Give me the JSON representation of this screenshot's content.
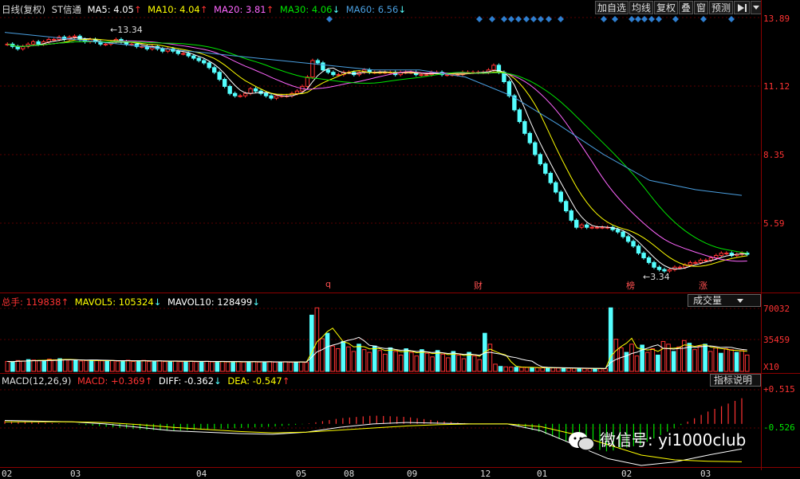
{
  "header": {
    "title": "日线(复权)",
    "stock": "ST信通",
    "ma5": "MA5: 4.05",
    "ma10": "MA10: 4.04",
    "ma20": "MA20: 3.81",
    "ma30": "MA30: 4.06",
    "ma60": "MA60: 6.56",
    "ma5_arrow": "↑",
    "ma10_arrow": "↑",
    "ma20_arrow": "↑",
    "ma30_arrow": "↓",
    "ma60_arrow": "↓",
    "buttons": [
      "加自选",
      "均线",
      "复权",
      "叠",
      "窗",
      "预测"
    ],
    "nav_icon": "play-icon",
    "dropdown_icon": "chevron-down-icon"
  },
  "colors": {
    "up": "#ff3232",
    "down": "#54ffff",
    "ma5": "#ffffff",
    "ma10": "#ffff00",
    "ma20": "#ff66ff",
    "ma30": "#00e600",
    "ma60": "#4a9fe0",
    "grid": "#8b0000"
  },
  "price_axis": [
    "13.89",
    "11.12",
    "8.35",
    "5.59"
  ],
  "annotations": {
    "high": "13.34",
    "low": "3.34"
  },
  "event_markers": [
    "q",
    "财",
    "榜",
    "涨"
  ],
  "volume_panel": {
    "total": "总手: 119838",
    "mavol5": "MAVOL5: 105324",
    "mavol10": "MAVOL10: 128499",
    "total_arrow": "↑",
    "mavol5_arrow": "↓",
    "mavol10_arrow": "↓",
    "selector": "成交量",
    "axis": [
      "70032",
      "35459",
      "X10"
    ]
  },
  "macd_panel": {
    "name": "MACD(12,26,9)",
    "macd": "MACD: +0.369",
    "diff": "DIFF: -0.362",
    "dea": "DEA: -0.547",
    "macd_arrow": "↑",
    "diff_arrow": "↓",
    "dea_arrow": "↑",
    "help": "指标说明",
    "axis": [
      "+0.515",
      "-0.526"
    ]
  },
  "x_dates": [
    "02",
    "03",
    "04",
    "05",
    "08",
    "09",
    "12",
    "01",
    "02",
    "03"
  ],
  "watermark": "微信号: yi1000club",
  "chart_data": {
    "type": "candlestick",
    "ylim": [
      3.0,
      14.2
    ],
    "close": [
      13.0,
      12.9,
      12.8,
      12.9,
      13.0,
      13.1,
      13.0,
      13.1,
      13.2,
      13.2,
      13.3,
      13.2,
      13.3,
      13.34,
      13.2,
      13.1,
      13.2,
      13.1,
      13.0,
      13.0,
      13.1,
      13.2,
      13.1,
      13.0,
      13.0,
      12.9,
      12.9,
      12.8,
      12.9,
      12.8,
      12.7,
      12.8,
      12.7,
      12.6,
      12.6,
      12.5,
      12.4,
      12.3,
      12.2,
      12.0,
      11.8,
      11.5,
      11.2,
      10.9,
      10.8,
      10.8,
      10.9,
      11.1,
      11.0,
      10.9,
      10.8,
      10.7,
      10.8,
      10.8,
      10.8,
      10.9,
      11.0,
      11.2,
      11.6,
      12.3,
      12.2,
      11.9,
      11.8,
      11.7,
      11.7,
      11.8,
      11.8,
      11.7,
      11.8,
      11.9,
      11.8,
      11.8,
      11.8,
      11.8,
      11.8,
      11.7,
      11.8,
      11.8,
      11.8,
      11.7,
      11.7,
      11.7,
      11.8,
      11.8,
      11.7,
      11.7,
      11.7,
      11.7,
      11.8,
      11.8,
      11.8,
      11.8,
      11.8,
      11.9,
      12.1,
      11.8,
      11.4,
      10.8,
      10.2,
      9.7,
      9.2,
      8.8,
      8.3,
      7.9,
      7.5,
      7.1,
      6.7,
      6.3,
      5.9,
      5.5,
      5.2,
      5.3,
      5.2,
      5.2,
      5.2,
      5.2,
      5.2,
      5.1,
      5.0,
      4.8,
      4.6,
      4.4,
      4.1,
      3.9,
      3.7,
      3.5,
      3.4,
      3.34,
      3.4,
      3.5,
      3.5,
      3.6,
      3.7,
      3.7,
      3.8,
      3.8,
      3.9,
      4.0,
      4.1,
      4.1,
      4.0,
      4.05,
      4.1,
      4.05
    ],
    "ma60": [
      13.5,
      13.3,
      13.1,
      12.9,
      12.7,
      12.5,
      12.3,
      12.1,
      11.9,
      11.9,
      11.6,
      10.8,
      9.6,
      8.3,
      7.2,
      6.8,
      6.56
    ],
    "volume_unit": "X10",
    "volume": [
      11000,
      10500,
      12000,
      11500,
      13000,
      12500,
      11800,
      12200,
      13500,
      12800,
      14000,
      13200,
      12600,
      12000,
      11500,
      11900,
      12400,
      12100,
      11700,
      11400,
      12000,
      11300,
      11800,
      12300,
      11000,
      11600,
      12100,
      10900,
      11200,
      11700,
      10800,
      11100,
      11500,
      10700,
      11000,
      11400,
      10600,
      10900,
      11200,
      10500,
      10800,
      11100,
      10400,
      10700,
      11000,
      10300,
      10600,
      10900,
      10200,
      10500,
      10800,
      10100,
      10400,
      10700,
      10000,
      10300,
      10600,
      9900,
      62000,
      70032,
      36000,
      42000,
      28000,
      25000,
      33000,
      27000,
      22000,
      30000,
      24000,
      21000,
      28000,
      23000,
      19000,
      26000,
      22000,
      18000,
      25000,
      21000,
      17000,
      24000,
      20000,
      16000,
      23000,
      19000,
      15000,
      22000,
      18000,
      14000,
      21000,
      17000,
      13000,
      42000,
      30000,
      8000,
      5500,
      5000,
      4800,
      4600,
      4400,
      4300,
      4200,
      4100,
      4000,
      3900,
      3800,
      3700,
      3600,
      3500,
      3400,
      3300,
      3200,
      3100,
      3000,
      2900,
      3000,
      70032,
      35459,
      26000,
      21000,
      30000,
      17000,
      29000,
      21000,
      25000,
      18000,
      33000,
      30000,
      22000,
      27000,
      34000,
      31000,
      24000,
      28000,
      30000,
      22000,
      26000,
      20000,
      25000,
      24000,
      21000,
      23000,
      18000
    ],
    "macd_range": [
      -0.6,
      0.55
    ],
    "diff": [
      0.05,
      0.04,
      0.03,
      0.0,
      -0.05,
      -0.1,
      -0.12,
      -0.14,
      -0.15,
      -0.12,
      -0.05,
      0.0,
      0.02,
      0.01,
      0.0,
      0.0,
      -0.1,
      -0.3,
      -0.5,
      -0.6,
      -0.55,
      -0.45,
      -0.362
    ],
    "dea": [
      0.03,
      0.03,
      0.03,
      0.02,
      -0.01,
      -0.05,
      -0.08,
      -0.11,
      -0.13,
      -0.12,
      -0.09,
      -0.06,
      -0.03,
      -0.01,
      0.0,
      0.0,
      -0.04,
      -0.15,
      -0.3,
      -0.45,
      -0.52,
      -0.54,
      -0.547
    ]
  }
}
